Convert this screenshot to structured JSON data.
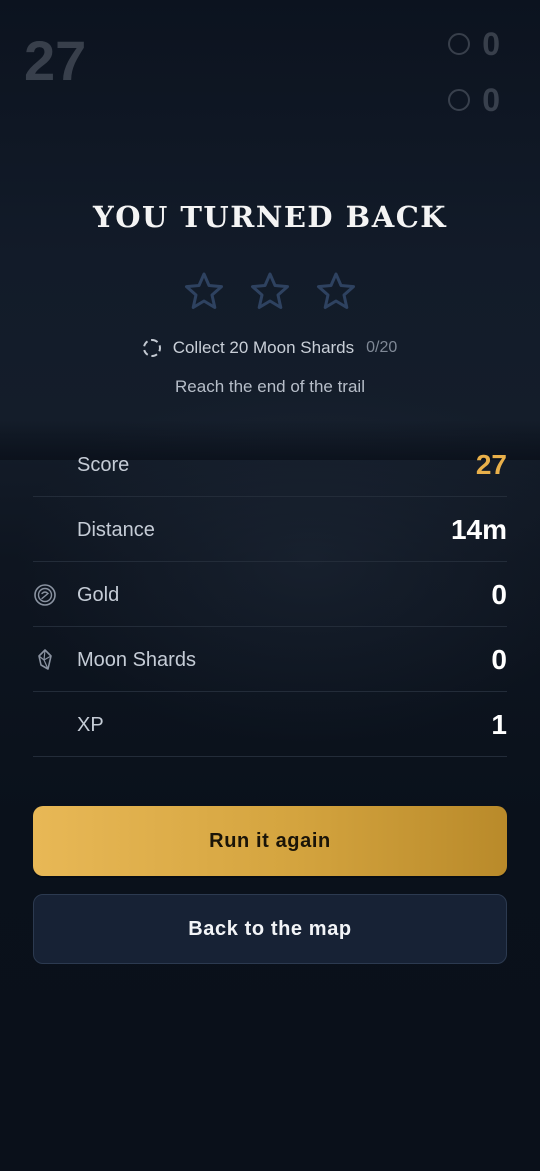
{
  "hud": {
    "score": "27",
    "gold": "0",
    "shards": "0"
  },
  "result": {
    "title": "YOU TURNED BACK",
    "stars_earned": 0,
    "stars_total": 3,
    "objective": {
      "text": "Collect 20 Moon Shards",
      "progress": "0/20"
    },
    "subtitle": "Reach the end of the trail"
  },
  "stats": [
    {
      "label": "Score",
      "value": "27",
      "icon": ""
    },
    {
      "label": "Distance",
      "value": "14m",
      "icon": ""
    },
    {
      "label": "Gold",
      "value": "0",
      "icon": "gold-coin-icon"
    },
    {
      "label": "Moon Shards",
      "value": "0",
      "icon": "moon-shard-icon"
    },
    {
      "label": "XP",
      "value": "1",
      "icon": ""
    }
  ],
  "buttons": {
    "primary": "Run it again",
    "secondary": "Back to the map"
  },
  "colors": {
    "accent_gold": "#e9b04a",
    "background": "#0d1421",
    "star_outline": "#2e4260"
  }
}
